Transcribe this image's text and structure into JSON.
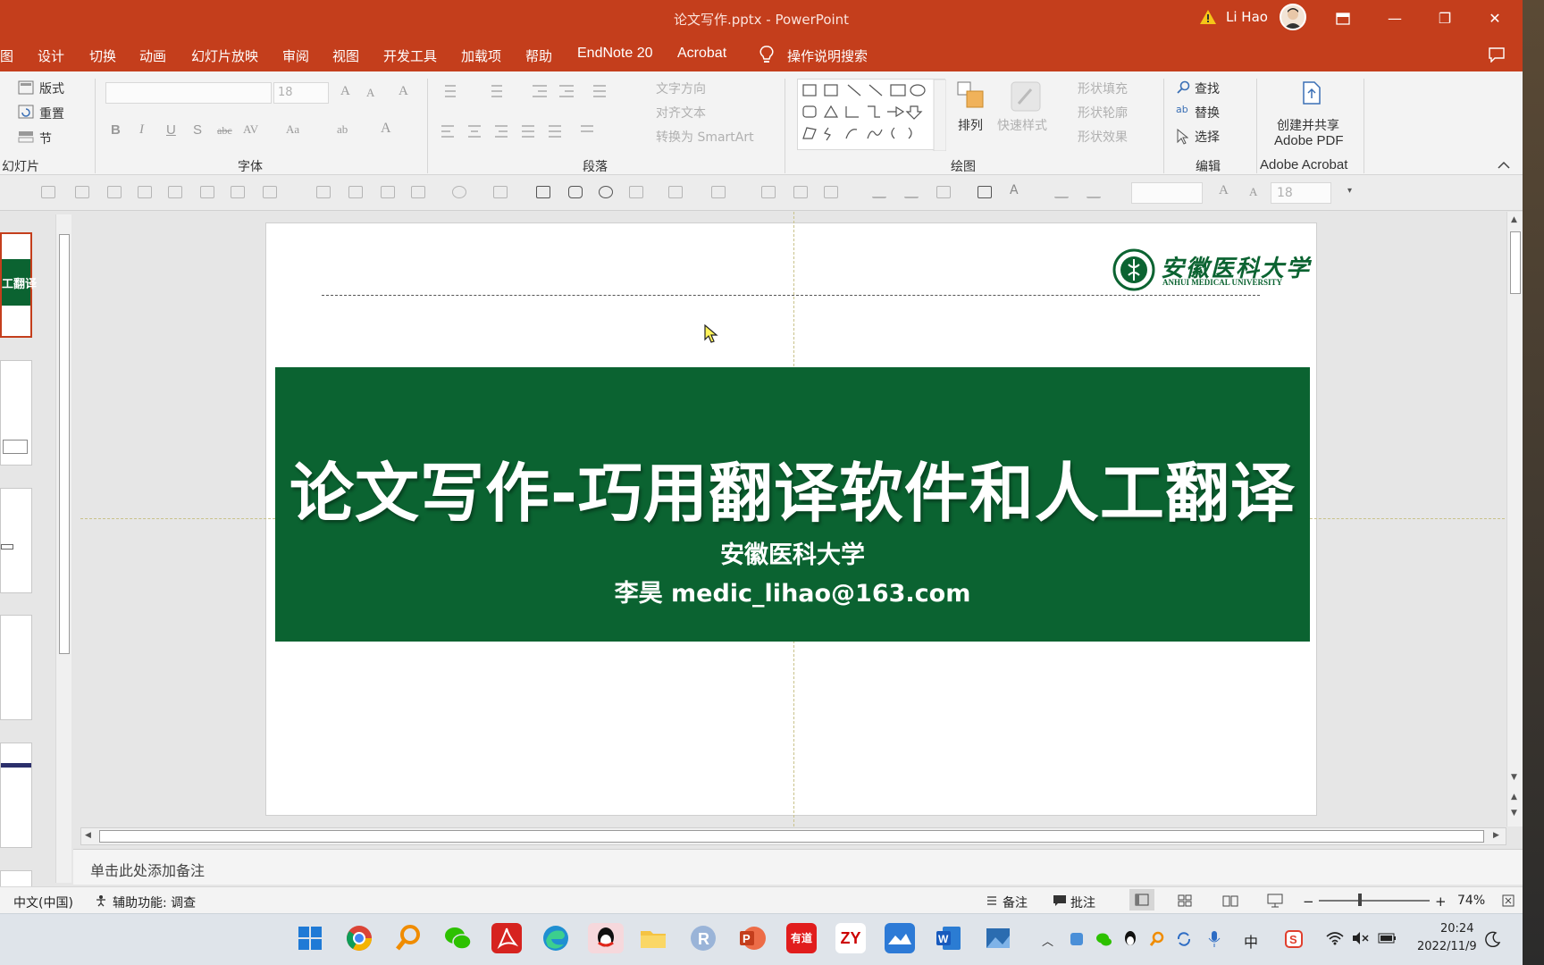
{
  "window": {
    "title": "论文写作.pptx  -  PowerPoint",
    "user": "Li Hao",
    "minimize": "—",
    "restore": "❐",
    "close": "✕"
  },
  "menu": {
    "items": [
      "图",
      "设计",
      "切换",
      "动画",
      "幻灯片放映",
      "审阅",
      "视图",
      "开发工具",
      "加载项",
      "帮助",
      "EndNote 20",
      "Acrobat",
      "操作说明搜索"
    ]
  },
  "ribbon": {
    "slides_group": {
      "label": "幻灯片",
      "layout": "版式",
      "reset": "重置",
      "section": "节"
    },
    "font_group": {
      "label": "字体",
      "size_value": "18"
    },
    "paragraph_group": {
      "label": "段落",
      "text_direction": "文字方向",
      "align_text": "对齐文本",
      "convert_smartart": "转换为 SmartArt"
    },
    "drawing_group": {
      "label": "绘图",
      "arrange": "排列",
      "quick_styles": "快速样式",
      "shape_fill": "形状填充",
      "shape_outline": "形状轮廓",
      "shape_effects": "形状效果"
    },
    "editing_group": {
      "label": "编辑",
      "find": "查找",
      "replace": "替换",
      "select": "选择"
    },
    "acrobat_group": {
      "label": "Adobe Acrobat",
      "create_share": "创建并共享",
      "adobe_pdf": "Adobe PDF"
    }
  },
  "toolbar2": {
    "font_size_value": "18"
  },
  "slide": {
    "logo_cn": "安徽医科大学",
    "logo_en": "ANHUI MEDICAL UNIVERSITY",
    "title": "论文写作-巧用翻译软件和人工翻译",
    "subtitle_school": "安徽医科大学",
    "subtitle_author": "李昊 medic_lihao@163.com"
  },
  "thumbnails": {
    "first_label": "工翻译"
  },
  "notes": {
    "placeholder": "单击此处添加备注"
  },
  "statusbar": {
    "language": "中文(中国)",
    "accessibility": "辅助功能: 调查",
    "notes_btn": "备注",
    "comments_btn": "批注",
    "zoom": "74%",
    "zoom_minus": "−",
    "zoom_plus": "+"
  },
  "taskbar": {
    "time": "20:24",
    "date": "2022/11/9",
    "ime": "中",
    "apps": [
      "Windows",
      "Chrome",
      "Search",
      "WeChat",
      "Acrobat",
      "Edge",
      "QQ",
      "Explorer",
      "R",
      "PowerPoint",
      "有道",
      "ZY",
      "Photos",
      "Word",
      "Pictures"
    ]
  },
  "colors": {
    "accent": "#c43e1c",
    "banner": "#0b6331"
  }
}
